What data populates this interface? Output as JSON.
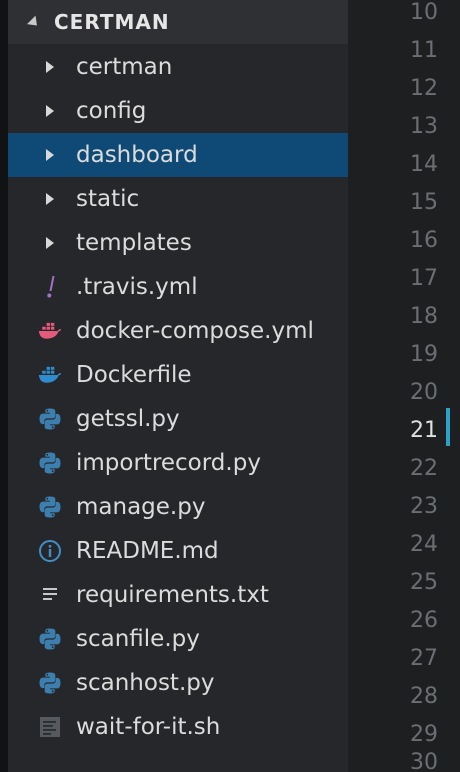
{
  "explorer": {
    "title": "CERTMAN",
    "items": [
      {
        "label": "certman",
        "type": "folder",
        "icon": "chevron-right-icon"
      },
      {
        "label": "config",
        "type": "folder",
        "icon": "chevron-right-icon"
      },
      {
        "label": "dashboard",
        "type": "folder",
        "icon": "chevron-right-icon",
        "selected": true
      },
      {
        "label": "static",
        "type": "folder",
        "icon": "chevron-right-icon"
      },
      {
        "label": "templates",
        "type": "folder",
        "icon": "chevron-right-icon"
      },
      {
        "label": ".travis.yml",
        "type": "file",
        "icon": "yaml-exclamation-icon"
      },
      {
        "label": "docker-compose.yml",
        "type": "file",
        "icon": "docker-icon"
      },
      {
        "label": "Dockerfile",
        "type": "file",
        "icon": "docker-icon"
      },
      {
        "label": "getssl.py",
        "type": "file",
        "icon": "python-icon"
      },
      {
        "label": "importrecord.py",
        "type": "file",
        "icon": "python-icon"
      },
      {
        "label": "manage.py",
        "type": "file",
        "icon": "python-icon"
      },
      {
        "label": "README.md",
        "type": "file",
        "icon": "info-icon"
      },
      {
        "label": "requirements.txt",
        "type": "file",
        "icon": "text-lines-icon"
      },
      {
        "label": "scanfile.py",
        "type": "file",
        "icon": "python-icon"
      },
      {
        "label": "scanhost.py",
        "type": "file",
        "icon": "python-icon"
      },
      {
        "label": "wait-for-it.sh",
        "type": "file",
        "icon": "shell-script-icon"
      }
    ]
  },
  "gutter": {
    "line_numbers": [
      "10",
      "11",
      "12",
      "13",
      "14",
      "15",
      "16",
      "17",
      "18",
      "19",
      "20",
      "21",
      "22",
      "23",
      "24",
      "25",
      "26",
      "27",
      "28",
      "29",
      "30"
    ],
    "current_line": "21"
  },
  "colors": {
    "selection": "#0e4a75",
    "python": "#3c7fae",
    "docker_pink": "#e45a7b",
    "docker_blue": "#2f8ccf",
    "yaml": "#a074c4",
    "info": "#3f8fc5",
    "cursor": "#2aa1c7"
  }
}
